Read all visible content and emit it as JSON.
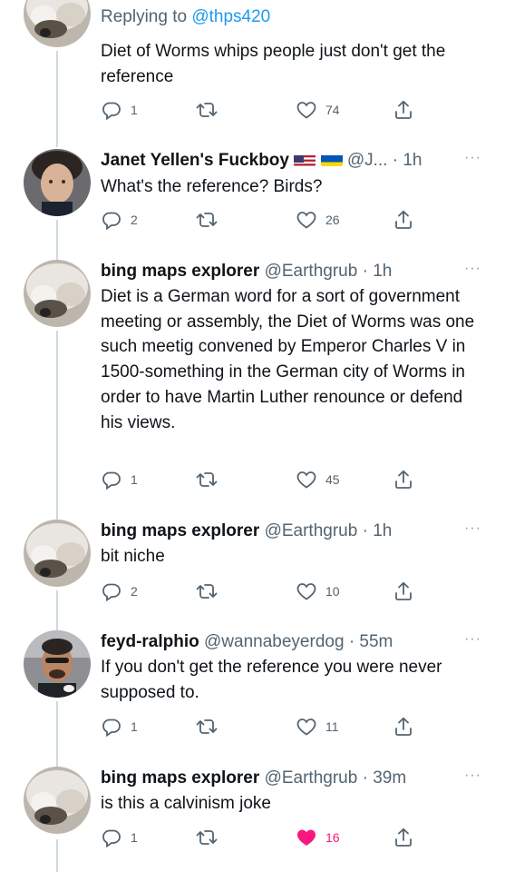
{
  "tweets": [
    {
      "reply_to_label": "Replying to",
      "reply_to_handle": "@thps420",
      "body": "Diet of Worms whips people just don't get the reference",
      "replies": "1",
      "retweets": "",
      "likes": "74",
      "liked": false
    },
    {
      "name": "Janet Yellen's Fuckboy",
      "flags": [
        "us-flag",
        "ukraine-flag"
      ],
      "handle": "@J...",
      "dot": "·",
      "time": "1h",
      "more": "···",
      "body": "What's the reference? Birds?",
      "replies": "2",
      "retweets": "",
      "likes": "26",
      "liked": false
    },
    {
      "name": "bing maps explorer",
      "handle": "@Earthgrub",
      "dot": "·",
      "time": "1h",
      "more": "···",
      "body": "Diet is a German word for a sort of government meeting or assembly, the Diet of Worms was one such meetig convened by Emperor Charles V in 1500-something in the German city of Worms in order to have Martin Luther renounce or defend his views.",
      "replies": "1",
      "retweets": "",
      "likes": "45",
      "liked": false
    },
    {
      "name": "bing maps explorer",
      "handle": "@Earthgrub",
      "dot": "·",
      "time": "1h",
      "more": "···",
      "body": "bit niche",
      "replies": "2",
      "retweets": "",
      "likes": "10",
      "liked": false
    },
    {
      "name": "feyd-ralphio",
      "handle": "@wannabeyerdog",
      "dot": "·",
      "time": "55m",
      "more": "···",
      "body": "If you don't get the reference you were never supposed to.",
      "replies": "1",
      "retweets": "",
      "likes": "11",
      "liked": false
    },
    {
      "name": "bing maps explorer",
      "handle": "@Earthgrub",
      "dot": "·",
      "time": "39m",
      "more": "···",
      "body": "is this a calvinism joke",
      "replies": "1",
      "retweets": "",
      "likes": "16",
      "liked": true
    }
  ],
  "colors": {
    "link": "#1d9bf0",
    "secondary": "#536471",
    "like_active": "#f91880",
    "thread_line": "#cfd9de"
  },
  "icons": [
    "reply-icon",
    "retweet-icon",
    "like-icon",
    "share-icon",
    "more-icon"
  ]
}
